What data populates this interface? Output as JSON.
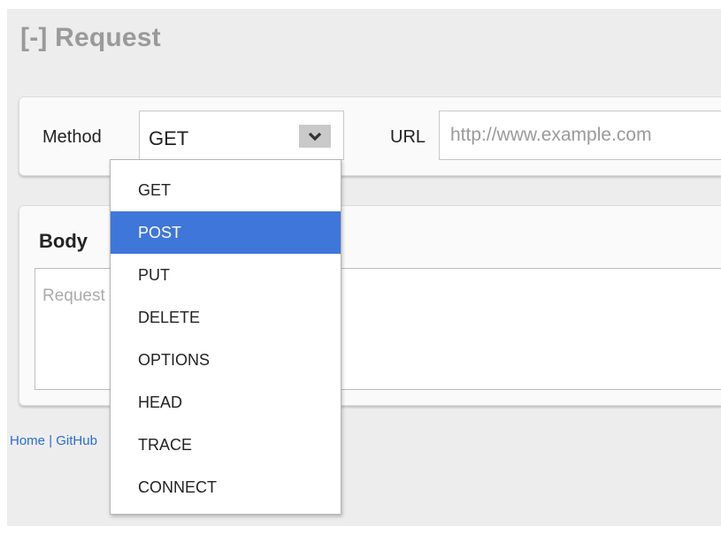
{
  "request": {
    "title": "[-] Request",
    "method_label": "Method",
    "method_value": "GET",
    "url_label": "URL",
    "url_placeholder": "http://www.example.com"
  },
  "body": {
    "title": "Body",
    "placeholder": "Request body"
  },
  "footer": {
    "home": "Home",
    "separator": "|",
    "github": "GitHub"
  },
  "dropdown": {
    "highlighted": "POST",
    "options": [
      "GET",
      "POST",
      "PUT",
      "DELETE",
      "OPTIONS",
      "HEAD",
      "TRACE",
      "CONNECT"
    ]
  },
  "icons": {
    "select_arrow": "chevron-down-icon"
  },
  "colors": {
    "highlight": "#3f76d9",
    "link": "#2a6bd6",
    "title": "#9a9a9a"
  }
}
